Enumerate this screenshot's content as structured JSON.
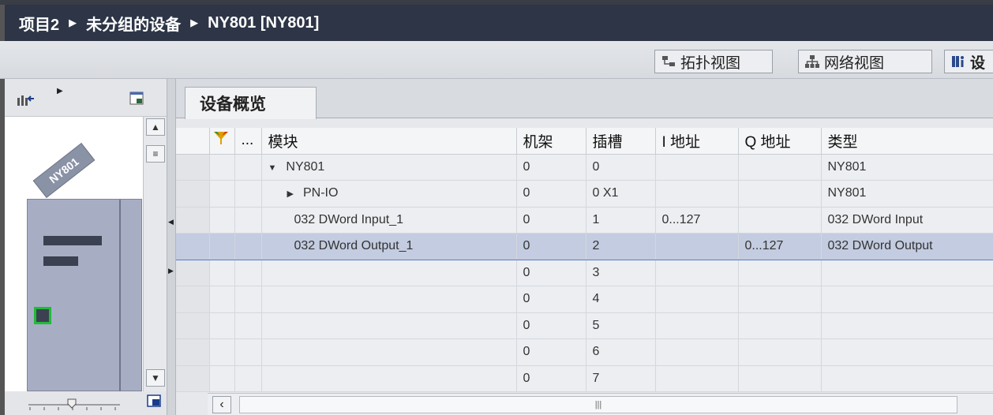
{
  "breadcrumb": {
    "project": "项目2",
    "group": "未分组的设备",
    "device": "NY801 [NY801]"
  },
  "view_tabs": {
    "topology": "拓扑视图",
    "network": "网络视图",
    "device": "设"
  },
  "left_panel": {
    "device_label": "NY801"
  },
  "overview_tab": {
    "label": "设备概览"
  },
  "grid": {
    "columns": {
      "dots": "...",
      "module": "模块",
      "rack": "机架",
      "slot": "插槽",
      "i_addr": "I 地址",
      "q_addr": "Q 地址",
      "type": "类型"
    },
    "rows": [
      {
        "module": "NY801",
        "rack": "0",
        "slot": "0",
        "i_addr": "",
        "q_addr": "",
        "type": "NY801"
      },
      {
        "module": "PN-IO",
        "rack": "0",
        "slot": "0 X1",
        "i_addr": "",
        "q_addr": "",
        "type": "NY801"
      },
      {
        "module": "032 DWord Input_1",
        "rack": "0",
        "slot": "1",
        "i_addr": "0...127",
        "q_addr": "",
        "type": "032 DWord Input"
      },
      {
        "module": "032 DWord Output_1",
        "rack": "0",
        "slot": "2",
        "i_addr": "",
        "q_addr": "0...127",
        "type": "032 DWord Output"
      },
      {
        "module": "",
        "rack": "0",
        "slot": "3",
        "i_addr": "",
        "q_addr": "",
        "type": ""
      },
      {
        "module": "",
        "rack": "0",
        "slot": "4",
        "i_addr": "",
        "q_addr": "",
        "type": ""
      },
      {
        "module": "",
        "rack": "0",
        "slot": "5",
        "i_addr": "",
        "q_addr": "",
        "type": ""
      },
      {
        "module": "",
        "rack": "0",
        "slot": "6",
        "i_addr": "",
        "q_addr": "",
        "type": ""
      },
      {
        "module": "",
        "rack": "0",
        "slot": "7",
        "i_addr": "",
        "q_addr": "",
        "type": ""
      }
    ]
  },
  "colors": {
    "title_bg": "#2d3547",
    "selected_row": "#c3cce0",
    "port_green": "#1fbb39"
  }
}
